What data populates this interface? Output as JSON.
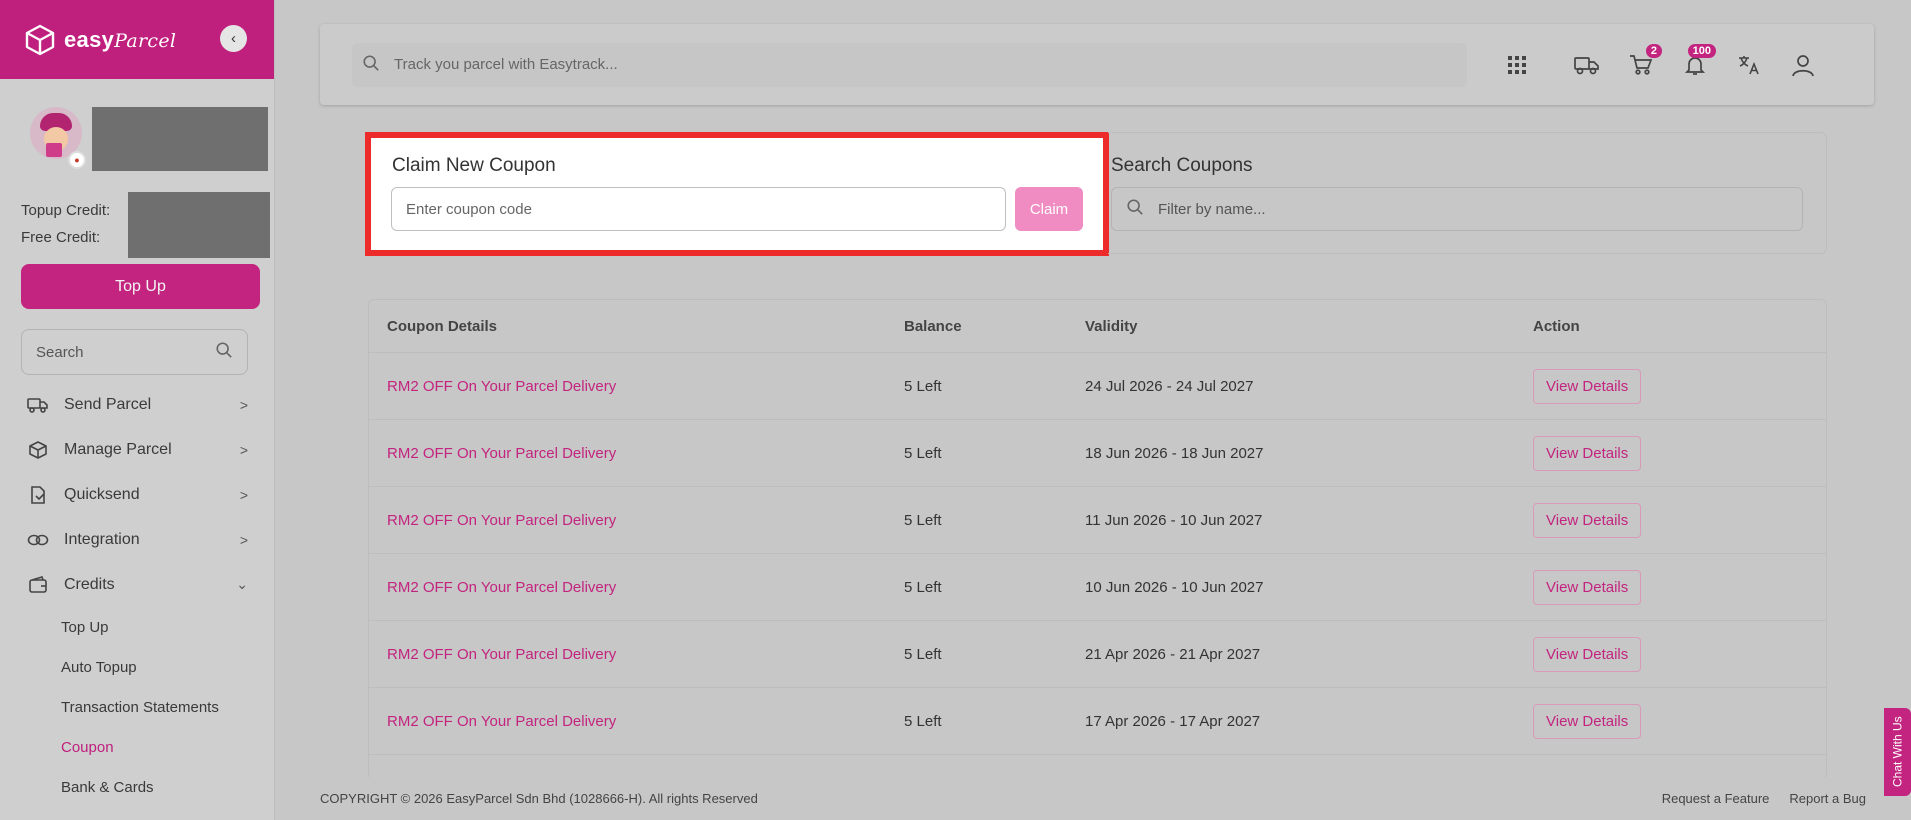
{
  "brand": {
    "name": "easy",
    "name_script": "Parcel"
  },
  "sidebar": {
    "topup_credit_label": "Topup Credit:",
    "free_credit_label": "Free Credit:",
    "topup_button": "Top Up",
    "search_placeholder": "Search",
    "nav": [
      {
        "label": "Send Parcel",
        "icon": "truck-icon"
      },
      {
        "label": "Manage Parcel",
        "icon": "box-icon"
      },
      {
        "label": "Quicksend",
        "icon": "quicksend-icon"
      },
      {
        "label": "Integration",
        "icon": "link-icon"
      },
      {
        "label": "Credits",
        "icon": "wallet-icon"
      }
    ],
    "credits_sub": [
      {
        "label": "Top Up"
      },
      {
        "label": "Auto Topup"
      },
      {
        "label": "Transaction Statements"
      },
      {
        "label": "Coupon"
      },
      {
        "label": "Bank & Cards"
      }
    ]
  },
  "topbar": {
    "track_placeholder": "Track you parcel with Easytrack...",
    "cart_count": "2",
    "notifications_count": "100"
  },
  "claim": {
    "title": "Claim New Coupon",
    "placeholder": "Enter coupon code",
    "button": "Claim"
  },
  "search_coupons": {
    "title": "Search Coupons",
    "placeholder": "Filter by name..."
  },
  "table": {
    "headers": [
      "Coupon Details",
      "Balance",
      "Validity",
      "Action"
    ],
    "rows": [
      {
        "name": "RM2 OFF On Your Parcel Delivery",
        "balance": "5 Left",
        "validity": "24 Jul 2026 - 24 Jul 2027",
        "action": "View Details"
      },
      {
        "name": "RM2 OFF On Your Parcel Delivery",
        "balance": "5 Left",
        "validity": "18 Jun 2026 - 18 Jun 2027",
        "action": "View Details"
      },
      {
        "name": "RM2 OFF On Your Parcel Delivery",
        "balance": "5 Left",
        "validity": "11 Jun 2026 - 10 Jun 2027",
        "action": "View Details"
      },
      {
        "name": "RM2 OFF On Your Parcel Delivery",
        "balance": "5 Left",
        "validity": "10 Jun 2026 - 10 Jun 2027",
        "action": "View Details"
      },
      {
        "name": "RM2 OFF On Your Parcel Delivery",
        "balance": "5 Left",
        "validity": "21 Apr 2026 - 21 Apr 2027",
        "action": "View Details"
      },
      {
        "name": "RM2 OFF On Your Parcel Delivery",
        "balance": "5 Left",
        "validity": "17 Apr 2026 - 17 Apr 2027",
        "action": "View Details"
      }
    ]
  },
  "footer": {
    "copyright": "COPYRIGHT © 2026 EasyParcel Sdn Bhd (1028666-H). All rights Reserved",
    "request_feature": "Request a Feature",
    "report_bug": "Report a Bug"
  },
  "chat_tab": "Chat With Us",
  "colors": {
    "brand": "#bf1f7d",
    "highlight_outline": "#ee2b2b",
    "claim_button": "#f08cc2"
  }
}
